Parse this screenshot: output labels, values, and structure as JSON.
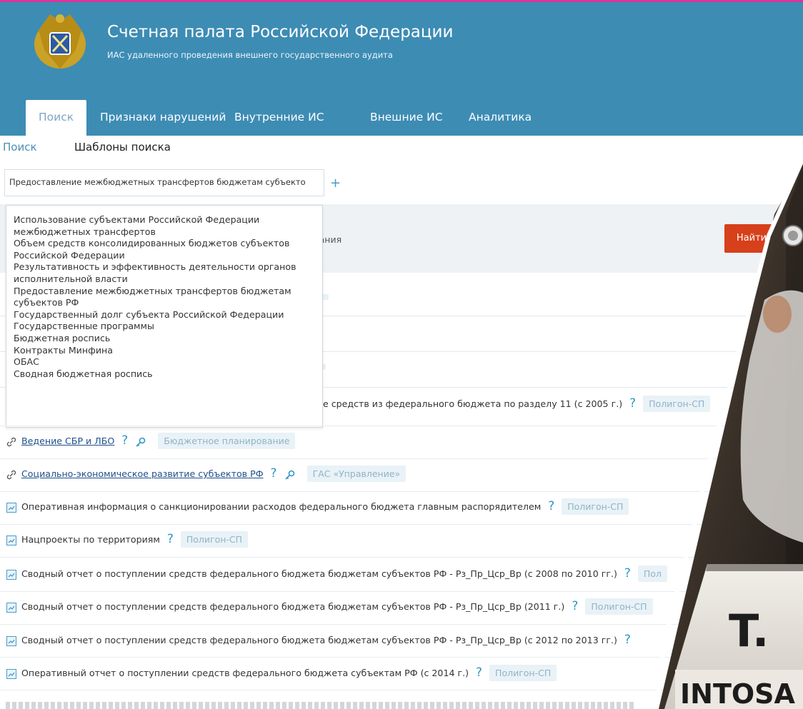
{
  "header": {
    "org_title": "Счетная палата Российской Федерации",
    "org_subtitle": "ИАС удаленного проведения внешнего государственного аудита"
  },
  "nav": {
    "tabs": [
      "Поиск",
      "Признаки нарушений",
      "Внутренние ИС",
      "Внешние ИС",
      "Аналитика"
    ],
    "active": "Поиск"
  },
  "subtabs": {
    "search": "Поиск",
    "templates": "Шаблоны поиска"
  },
  "template_select": {
    "value": "Предоставление межбюджетных трансфертов бюджетам субъекто",
    "add": "+"
  },
  "filter": {
    "partial_text": "зания",
    "find_button": "Найти"
  },
  "dropdown": {
    "items": [
      "Использование субъектами Российской Федерации межбюджетных трансфертов",
      "Объем средств консолидированных бюджетов субъектов Российской Федерации",
      "Результативность и эффективность деятельности органов исполнительной власти",
      "Предоставление межбюджетных трансфертов бюджетам субъектов РФ",
      "Государственный долг субъекта Российской Федерации",
      "Государственные программы",
      "Бюджетная роспись",
      "Контракты Минфина",
      "ОБАС",
      "Сводная бюджетная роспись"
    ]
  },
  "results": [
    {
      "title": "е средств из федерального бюджета по разделу 11 (с 2005 г.)",
      "tag": "Полигон-СП",
      "kind": "partial"
    },
    {
      "title": "Ведение СБР и ЛБО",
      "tag": "Бюджетное планирование",
      "kind": "link"
    },
    {
      "title": "Социально-экономическое развитие субъектов РФ",
      "tag": "ГАС «Управление»",
      "kind": "link"
    },
    {
      "title": "Оперативная информация о санкционировании расходов федерального бюджета главным распорядителем",
      "tag": "Полигон-СП",
      "kind": "report"
    },
    {
      "title": "Нацпроекты по территориям",
      "tag": "Полигон-СП",
      "kind": "report"
    },
    {
      "title": "Сводный отчет о поступлении средств федерального бюджета бюджетам субъектов РФ - Рз_Пр_Цср_Вр (с 2008 по 2010 гг.)",
      "tag": "Пол",
      "kind": "report"
    },
    {
      "title": "Сводный отчет о поступлении средств федерального бюджета бюджетам субъектов РФ - Рз_Пр_Цср_Вр (2011 г.)",
      "tag": "Полигон-СП",
      "kind": "report"
    },
    {
      "title": "Сводный отчет о поступлении средств федерального бюджета бюджетам субъектов РФ - Рз_Пр_Цср_Вр (с 2012 по 2013 гг.)",
      "tag": "",
      "kind": "report"
    },
    {
      "title": "Оперативный отчет о поступлении средств федерального бюджета субъектам РФ (с 2014 г.)",
      "tag": "Полигон-СП",
      "kind": "report"
    }
  ],
  "help_mark": "?",
  "photo": {
    "nameplate_big": "T.",
    "nameplate_small": "INTOSA"
  },
  "colors": {
    "header_bg": "#3d8cb4",
    "accent_button": "#d6401a",
    "link": "#1f4f8a",
    "tag_bg": "#e9f2f6"
  }
}
